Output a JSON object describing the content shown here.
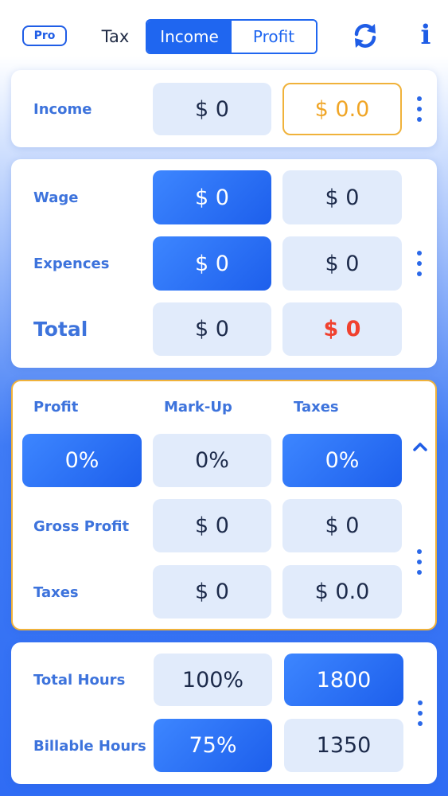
{
  "header": {
    "pro_label": "Pro",
    "tab_tax": "Tax",
    "tab_income": "Income",
    "tab_profit": "Profit",
    "info_label": "i"
  },
  "income": {
    "label": "Income",
    "value1": "$ 0",
    "value2": "$ 0.0"
  },
  "wage_section": {
    "wage_label": "Wage",
    "wage_value1": "$ 0",
    "wage_value2": "$ 0",
    "expences_label": "Expences",
    "expences_value1": "$ 0",
    "expences_value2": "$ 0",
    "total_label": "Total",
    "total_value1": "$ 0",
    "total_value2": "$ 0"
  },
  "profit_section": {
    "col_profit": "Profit",
    "col_markup": "Mark-Up",
    "col_taxes": "Taxes",
    "profit_pct": "0%",
    "markup_pct": "0%",
    "taxes_pct": "0%",
    "gross_label": "Gross Profit",
    "gross_value1": "$ 0",
    "gross_value2": "$ 0",
    "taxes_label": "Taxes",
    "taxes_value1": "$ 0",
    "taxes_value2": "$ 0.0"
  },
  "hours_section": {
    "total_hours_label": "Total Hours",
    "total_hours_pct": "100%",
    "total_hours_value": "1800",
    "billable_label": "Billable Hours",
    "billable_pct": "75%",
    "billable_value": "1350"
  },
  "colors": {
    "accent": "#1f66f0",
    "label_blue": "#3d73dc",
    "light_box": "#e1ebfb",
    "orange": "#f0b23a",
    "red": "#f0412f"
  }
}
